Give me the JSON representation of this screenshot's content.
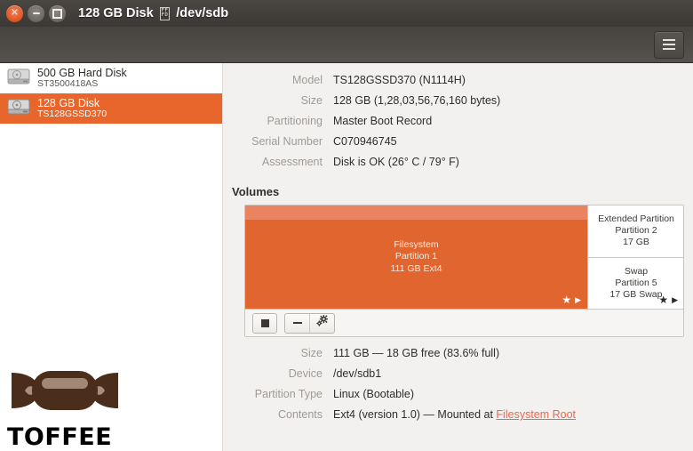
{
  "window": {
    "title": "128 GB Disk",
    "title_tofu": "FFFD",
    "device_path": "/dev/sdb",
    "close_label": "×",
    "minimize_label": "−",
    "maximize_label": "□",
    "menu_label": "hamburger-menu"
  },
  "sidebar": {
    "disks": [
      {
        "name": "500 GB Hard Disk",
        "model": "ST3500418AS",
        "selected": false
      },
      {
        "name": "128 GB Disk",
        "model": "TS128GSSD370",
        "selected": true
      }
    ]
  },
  "drive_details": [
    {
      "label": "Model",
      "value": "TS128GSSD370 (N1114H)"
    },
    {
      "label": "Size",
      "value": "128 GB (1,28,03,56,76,160 bytes)"
    },
    {
      "label": "Partitioning",
      "value": "Master Boot Record"
    },
    {
      "label": "Serial Number",
      "value": "C070946745"
    },
    {
      "label": "Assessment",
      "value": "Disk is OK (26° C / 79° F)"
    }
  ],
  "volumes": {
    "section_title": "Volumes",
    "selected_partition": {
      "line1": "Filesystem",
      "line2": "Partition 1",
      "line3": "111 GB Ext4"
    },
    "extended_partition": {
      "line1": "Extended Partition",
      "line2": "Partition 2",
      "line3": "17 GB"
    },
    "swap_partition": {
      "line1": "Swap",
      "line2": "Partition 5",
      "line3": "17 GB Swap"
    },
    "star_glyph": "★",
    "triangle_glyph": "▶",
    "toolbar": {
      "stop_label": "stop-button",
      "delete_label": "delete-partition",
      "more_label": "more-actions"
    }
  },
  "volume_details": [
    {
      "label": "Size",
      "value": "111 GB — 18 GB free (83.6% full)"
    },
    {
      "label": "Device",
      "value": "/dev/sdb1"
    },
    {
      "label": "Partition Type",
      "value": "Linux (Bootable)"
    }
  ],
  "contents_row": {
    "label": "Contents",
    "prefix": "Ext4 (version 1.0) — Mounted at ",
    "link": "Filesystem Root"
  },
  "watermark": {
    "text": "TOFFEE"
  }
}
